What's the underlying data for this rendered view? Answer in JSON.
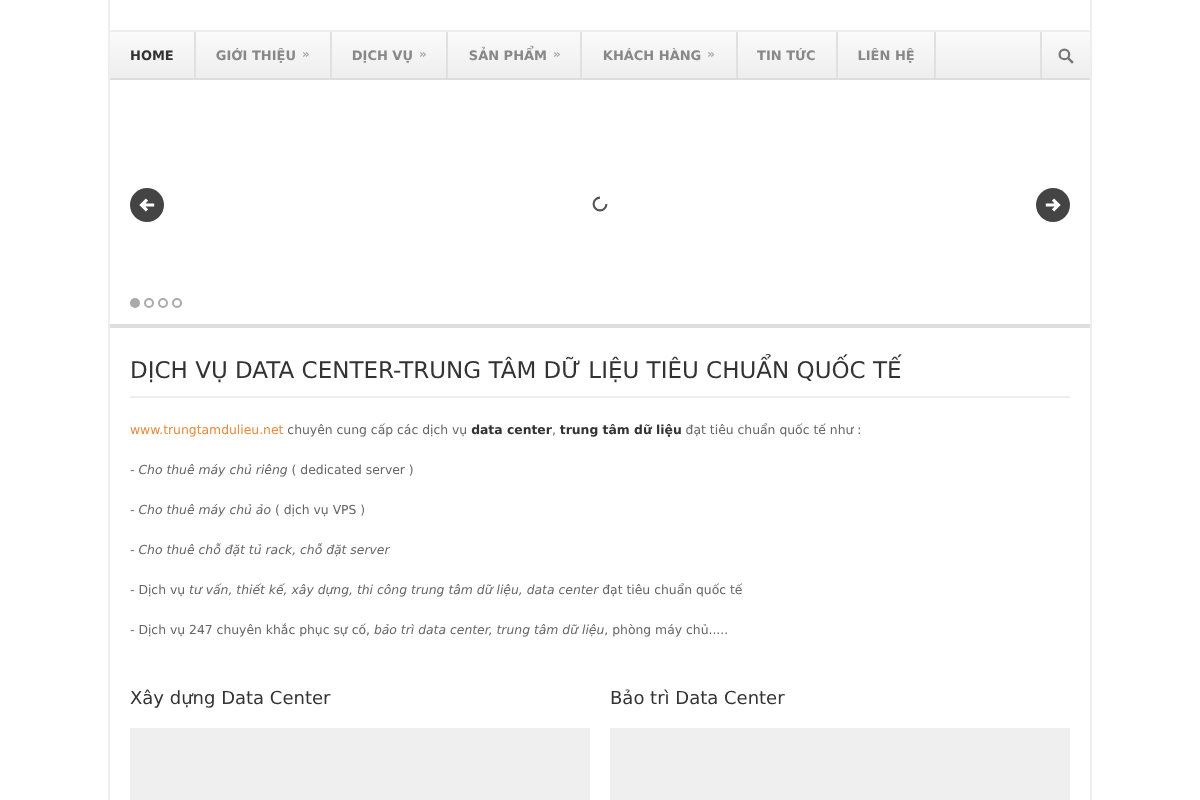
{
  "nav": {
    "items": [
      {
        "label": "HOME",
        "selected": true
      },
      {
        "label": "GIỚI THIỆU",
        "caret": "»",
        "selected": false
      },
      {
        "label": "DỊCH VỤ",
        "caret": "»",
        "selected": false
      },
      {
        "label": "SẢN PHẨM",
        "caret": "»",
        "selected": false
      },
      {
        "label": "KHÁCH HÀNG",
        "caret": "»",
        "selected": false
      },
      {
        "label": "TIN TỨC",
        "selected": false
      },
      {
        "label": "LIÊN HỆ",
        "selected": false
      }
    ]
  },
  "slider": {
    "dots": [
      {
        "selected": true
      },
      {
        "selected": false
      },
      {
        "selected": false
      },
      {
        "selected": false
      }
    ]
  },
  "article": {
    "title": "DỊCH VỤ DATA CENTER-TRUNG TÂM DỮ LIỆU TIÊU CHUẨN QUỐC TẾ",
    "intro": {
      "link": "www.trungtamdulieu.net",
      "text": "chuyên cung cấp các dịch vụ **data center**, **trung tâm dữ liệu** đạt tiêu chuẩn quốc tế như :"
    },
    "lines": [
      "- *Cho thuê máy chủ riêng* ( dedicated server )",
      "- *Cho thuê máy chủ ảo* ( dịch vụ VPS )",
      "- *Cho thuê chỗ đặt tủ rack, chỗ đặt server*",
      "- Dịch vụ *tư vấn, thiết kế, xây dựng, thi công trung tâm dữ liệu, data center* đạt tiêu chuẩn quốc tế",
      "- Dịch vụ 247 chuyên khắc phục sự cố, *bảo trì data center, trung tâm dữ liệu*, phòng máy chủ....."
    ]
  },
  "columns": [
    {
      "title": "Xây dựng Data Center"
    },
    {
      "title": "Bảo trì Data Center"
    }
  ]
}
